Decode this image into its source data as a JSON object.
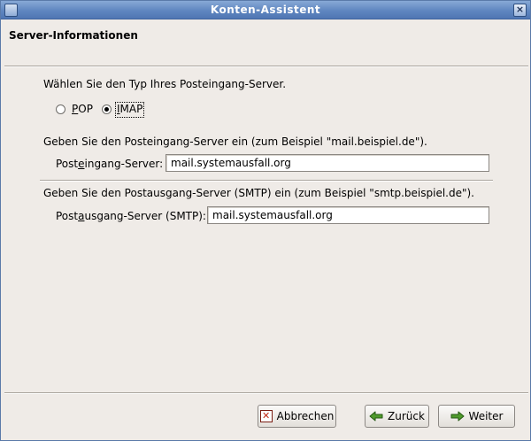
{
  "window": {
    "title": "Konten-Assistent"
  },
  "header": {
    "title": "Server-Informationen"
  },
  "server_type": {
    "prompt": "Wählen Sie den Typ Ihres Posteingang-Server.",
    "pop_label_mnemonic": "P",
    "pop_label_rest": "OP",
    "imap_label_mnemonic": "I",
    "imap_label_rest": "MAP",
    "selected": "IMAP"
  },
  "incoming": {
    "prompt": "Geben Sie den Posteingang-Server ein (zum Beispiel \"mail.beispiel.de\").",
    "label_pre": "Post",
    "label_mnemonic": "e",
    "label_post": "ingang-Server:",
    "value": "mail.systemausfall.org"
  },
  "outgoing": {
    "prompt": "Geben Sie den Postausgang-Server (SMTP) ein (zum Beispiel \"smtp.beispiel.de\").",
    "label_pre": "Post",
    "label_mnemonic": "a",
    "label_post": "usgang-Server (SMTP):",
    "value": "mail.systemausfall.org"
  },
  "buttons": {
    "cancel": "Abbrechen",
    "back": "Zurück",
    "next": "Weiter"
  },
  "icons": {
    "cancel": "cancel-x-icon",
    "back": "green-arrow-left-icon",
    "next": "green-arrow-right-icon"
  }
}
